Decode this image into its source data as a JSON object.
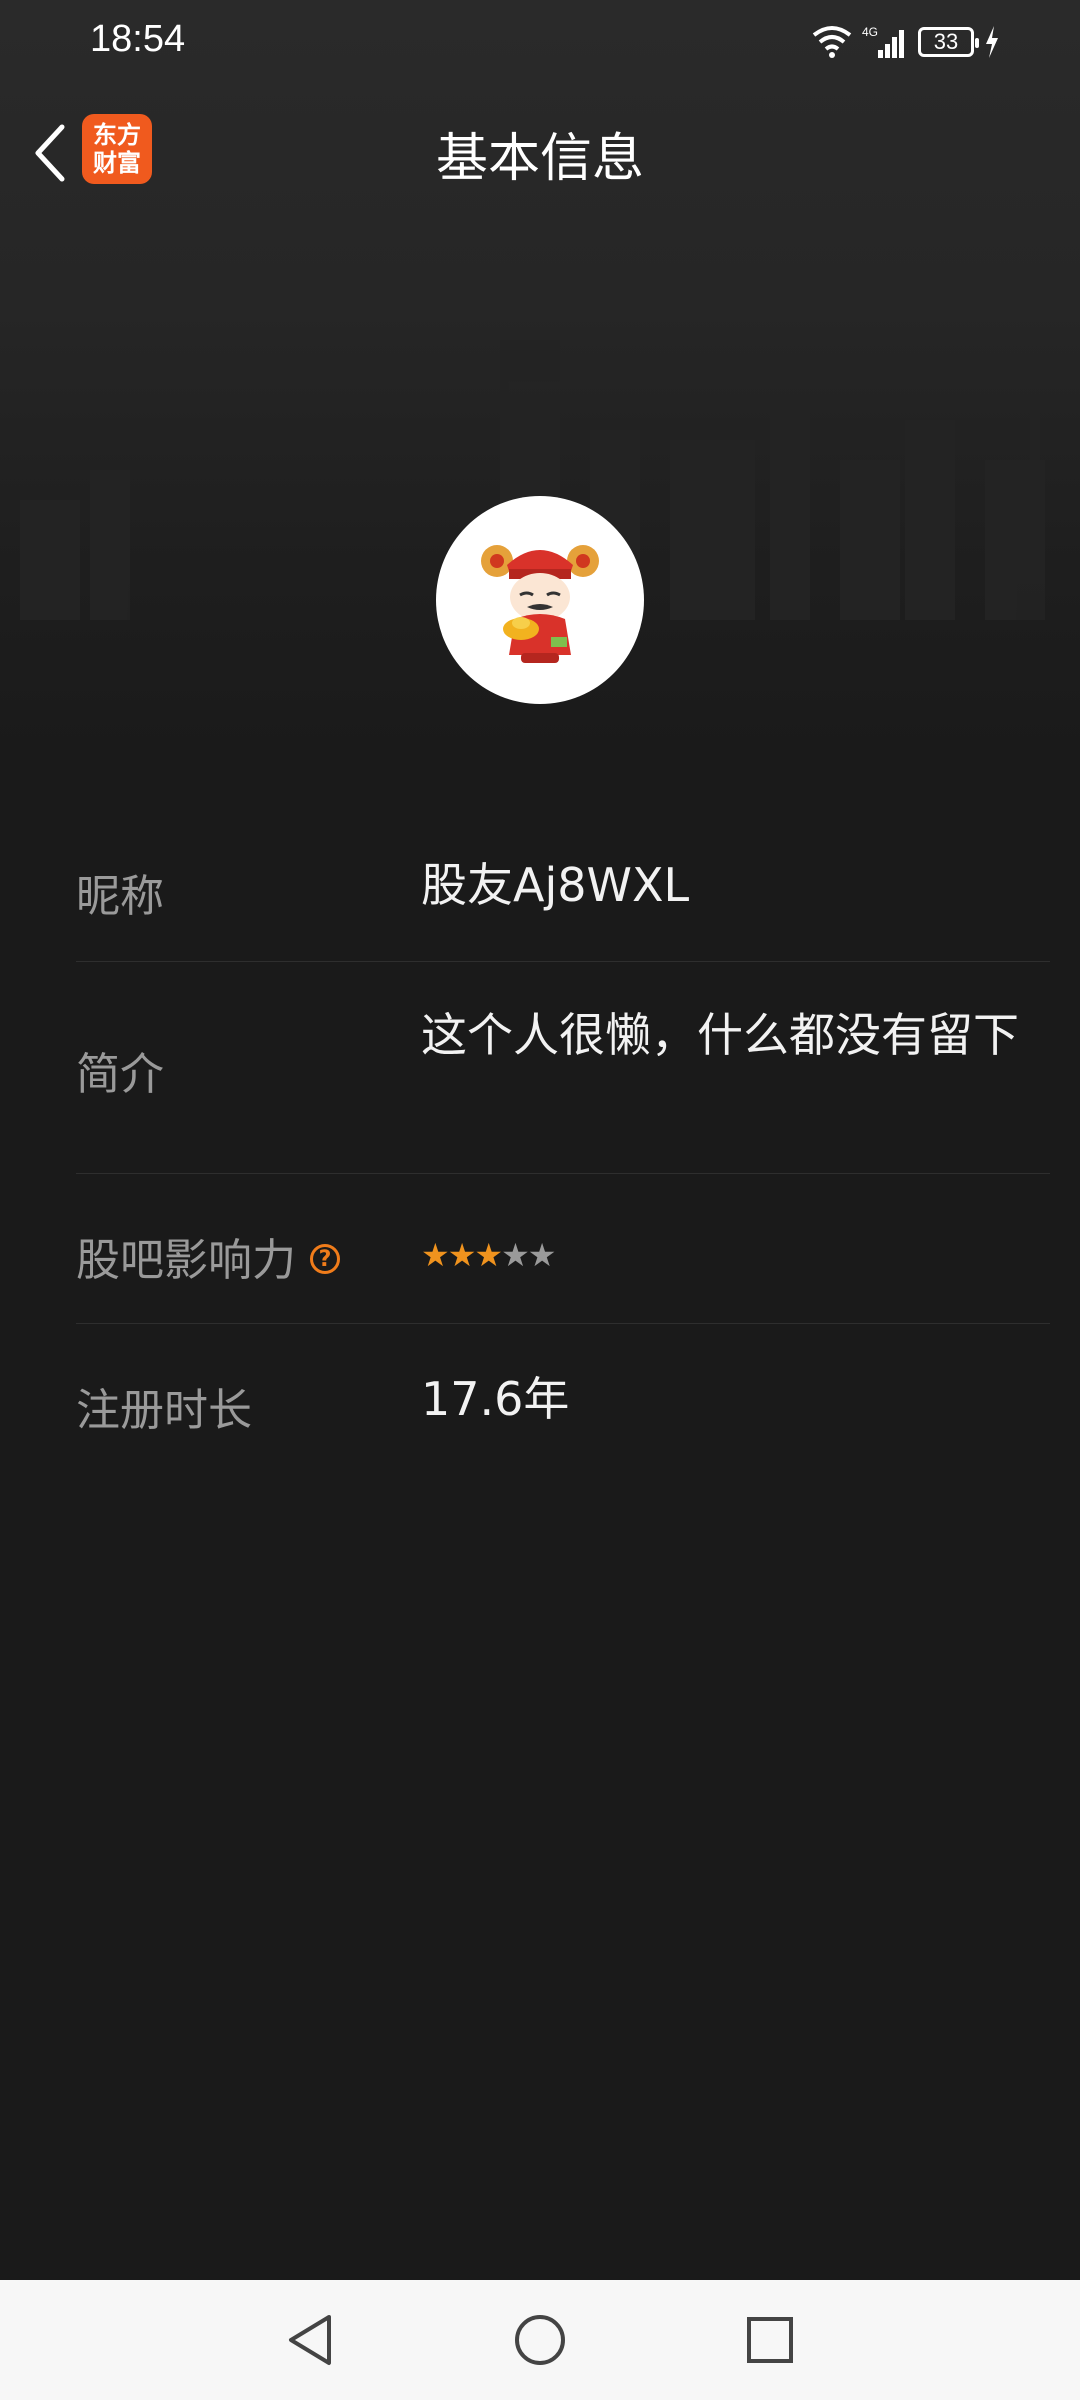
{
  "status_bar": {
    "time": "18:54",
    "network": "4G",
    "battery": "33"
  },
  "header": {
    "title": "基本信息",
    "app_logo_line1": "东方",
    "app_logo_line2": "财富"
  },
  "profile": {
    "rows": [
      {
        "label": "昵称",
        "value": "股友Aj8WXL"
      },
      {
        "label": "简介",
        "value": "这个人很懒，什么都没有留下"
      },
      {
        "label": "股吧影响力",
        "help": "?",
        "rating": 3,
        "rating_max": 5
      },
      {
        "label": "注册时长",
        "value": "17.6年"
      }
    ]
  },
  "colors": {
    "accent": "#f0931e",
    "logo": "#f05a1e",
    "background": "#1a1a1a"
  },
  "icons": {
    "back": "chevron-left-icon",
    "help": "question-circle-icon",
    "nav_back": "triangle-back-icon",
    "nav_home": "circle-home-icon",
    "nav_recents": "square-recents-icon"
  }
}
